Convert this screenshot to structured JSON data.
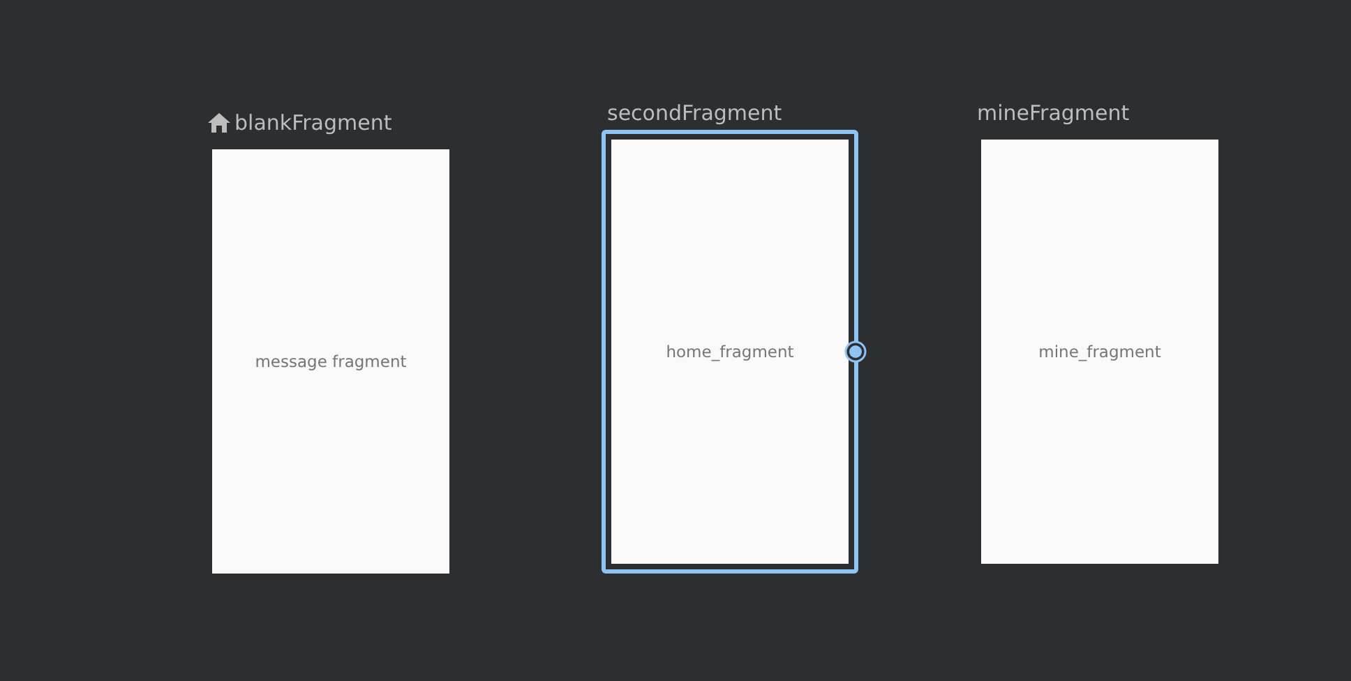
{
  "destinations": [
    {
      "name": "blankFragment",
      "preview_text": "message fragment",
      "start": true,
      "selected": false
    },
    {
      "name": "secondFragment",
      "preview_text": "home_fragment",
      "start": false,
      "selected": true
    },
    {
      "name": "mineFragment",
      "preview_text": "mine_fragment",
      "start": false,
      "selected": false
    }
  ]
}
